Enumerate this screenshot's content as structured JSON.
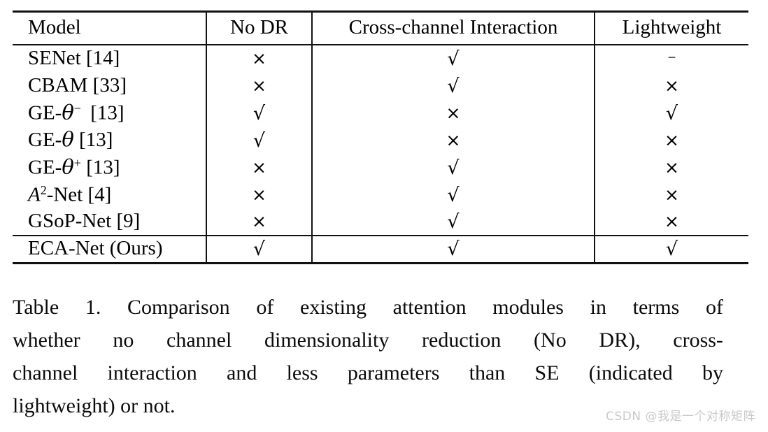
{
  "table": {
    "columns": [
      {
        "id": "model",
        "label": "Model",
        "align": "left"
      },
      {
        "id": "no_dr",
        "label": "No DR",
        "align": "center"
      },
      {
        "id": "cross",
        "label": "Cross-channel Interaction",
        "align": "center"
      },
      {
        "id": "light",
        "label": "Lightweight",
        "align": "center"
      }
    ],
    "rows": [
      {
        "model": "SENet [14]",
        "model_html": "SENet [14]",
        "no_dr": "×",
        "cross": "√",
        "light": "–"
      },
      {
        "model": "CBAM [33]",
        "model_html": "CBAM [33]",
        "no_dr": "×",
        "cross": "√",
        "light": "×"
      },
      {
        "model": "GE-θ− [13]",
        "model_html": "GE-<span class=\"theta\">θ</span><sup class=\"sm\">−</sup><span class=\"refsp\"></span> [13]",
        "no_dr": "√",
        "cross": "×",
        "light": "√"
      },
      {
        "model": "GE-θ [13]",
        "model_html": "GE-<span class=\"theta\">θ</span> [13]",
        "no_dr": "√",
        "cross": "×",
        "light": "×"
      },
      {
        "model": "GE-θ+ [13]",
        "model_html": "GE-<span class=\"theta\">θ</span><sup class=\"sm\">+</sup> [13]",
        "no_dr": "×",
        "cross": "√",
        "light": "×"
      },
      {
        "model": "A2-Net [4]",
        "model_html": "<span class=\"ital\">A</span><sup class=\"sm\">2</sup>-Net [4]",
        "no_dr": "×",
        "cross": "√",
        "light": "×"
      },
      {
        "model": "GSoP-Net [9]",
        "model_html": "GSoP-Net [9]",
        "no_dr": "×",
        "cross": "√",
        "light": "×"
      }
    ],
    "highlight_row": {
      "model": "ECA-Net (Ours)",
      "model_html": "ECA-Net (Ours)",
      "no_dr": "√",
      "cross": "√",
      "light": "√"
    },
    "symbol_legend": {
      "check": "√",
      "cross": "×",
      "dash": "–"
    }
  },
  "caption": {
    "lines": [
      "Table 1. Comparison of existing attention modules in terms of",
      "whether no channel dimensionality reduction (No DR), cross-",
      "channel interaction and less parameters than SE (indicated by",
      "lightweight) or not."
    ]
  },
  "watermark": {
    "text": "CSDN @我是一个对称矩阵"
  },
  "colors": {
    "background": "#ffffff",
    "text": "#000000",
    "rule": "#111111",
    "watermark": "#c9c9c9"
  }
}
